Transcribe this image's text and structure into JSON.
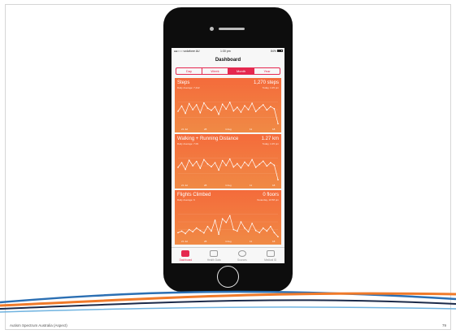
{
  "phone": {
    "status": {
      "carrier": "●●○○○ vodafone AU",
      "time": "1:30 pm",
      "battery": "84%"
    },
    "title": "Dashboard",
    "segments": [
      {
        "label": "Day",
        "active": false
      },
      {
        "label": "Week",
        "active": false
      },
      {
        "label": "Month",
        "active": true
      },
      {
        "label": "Year",
        "active": false
      }
    ],
    "cards": [
      {
        "title": "Steps",
        "subtitle": "Daily Average: 7,442",
        "value": "1,270 steps",
        "date": "Today, 1:25 pm",
        "xlabels": [
          "21 Jul",
          "28",
          "4 Aug",
          "11",
          "18"
        ],
        "points": [
          0.45,
          0.62,
          0.38,
          0.7,
          0.5,
          0.66,
          0.4,
          0.72,
          0.55,
          0.48,
          0.6,
          0.35,
          0.68,
          0.52,
          0.74,
          0.46,
          0.58,
          0.42,
          0.63,
          0.5,
          0.71,
          0.44,
          0.56,
          0.66,
          0.49,
          0.6,
          0.53,
          0.05
        ]
      },
      {
        "title": "Walking + Running Distance",
        "subtitle": "Daily Average: 7.09",
        "value": "1.27 km",
        "date": "Today, 1:25 pm",
        "xlabels": [
          "21 Jul",
          "28",
          "4 Aug",
          "11",
          "18"
        ],
        "points": [
          0.45,
          0.6,
          0.38,
          0.68,
          0.5,
          0.64,
          0.42,
          0.7,
          0.56,
          0.47,
          0.6,
          0.36,
          0.67,
          0.51,
          0.72,
          0.46,
          0.57,
          0.43,
          0.62,
          0.5,
          0.7,
          0.45,
          0.55,
          0.65,
          0.49,
          0.6,
          0.52,
          0.05
        ]
      },
      {
        "title": "Flights Climbed",
        "subtitle": "Daily Average: 6",
        "value": "0 floors",
        "date": "Yesterday, 10:58 pm",
        "xlabels": [
          "21 Jul",
          "28",
          "4 Aug",
          "11",
          "18"
        ],
        "points": [
          0.15,
          0.2,
          0.12,
          0.25,
          0.18,
          0.3,
          0.22,
          0.14,
          0.35,
          0.2,
          0.55,
          0.1,
          0.6,
          0.48,
          0.7,
          0.25,
          0.2,
          0.5,
          0.3,
          0.18,
          0.45,
          0.22,
          0.15,
          0.3,
          0.2,
          0.35,
          0.15,
          0.02
        ]
      }
    ],
    "tabs": [
      {
        "label": "Dashboard",
        "active": true
      },
      {
        "label": "Health Data",
        "active": false
      },
      {
        "label": "Sources",
        "active": false
      },
      {
        "label": "Medical ID",
        "active": false
      }
    ]
  },
  "footer": {
    "org": "Autism Spectrum Australia (Aspect)",
    "page": "79"
  },
  "colors": {
    "accent": "#e5284f",
    "card": "#f46b3b",
    "wave_blue": "#2b6fb3",
    "wave_orange": "#f07a2a",
    "wave_navy": "#1b2a4a"
  }
}
